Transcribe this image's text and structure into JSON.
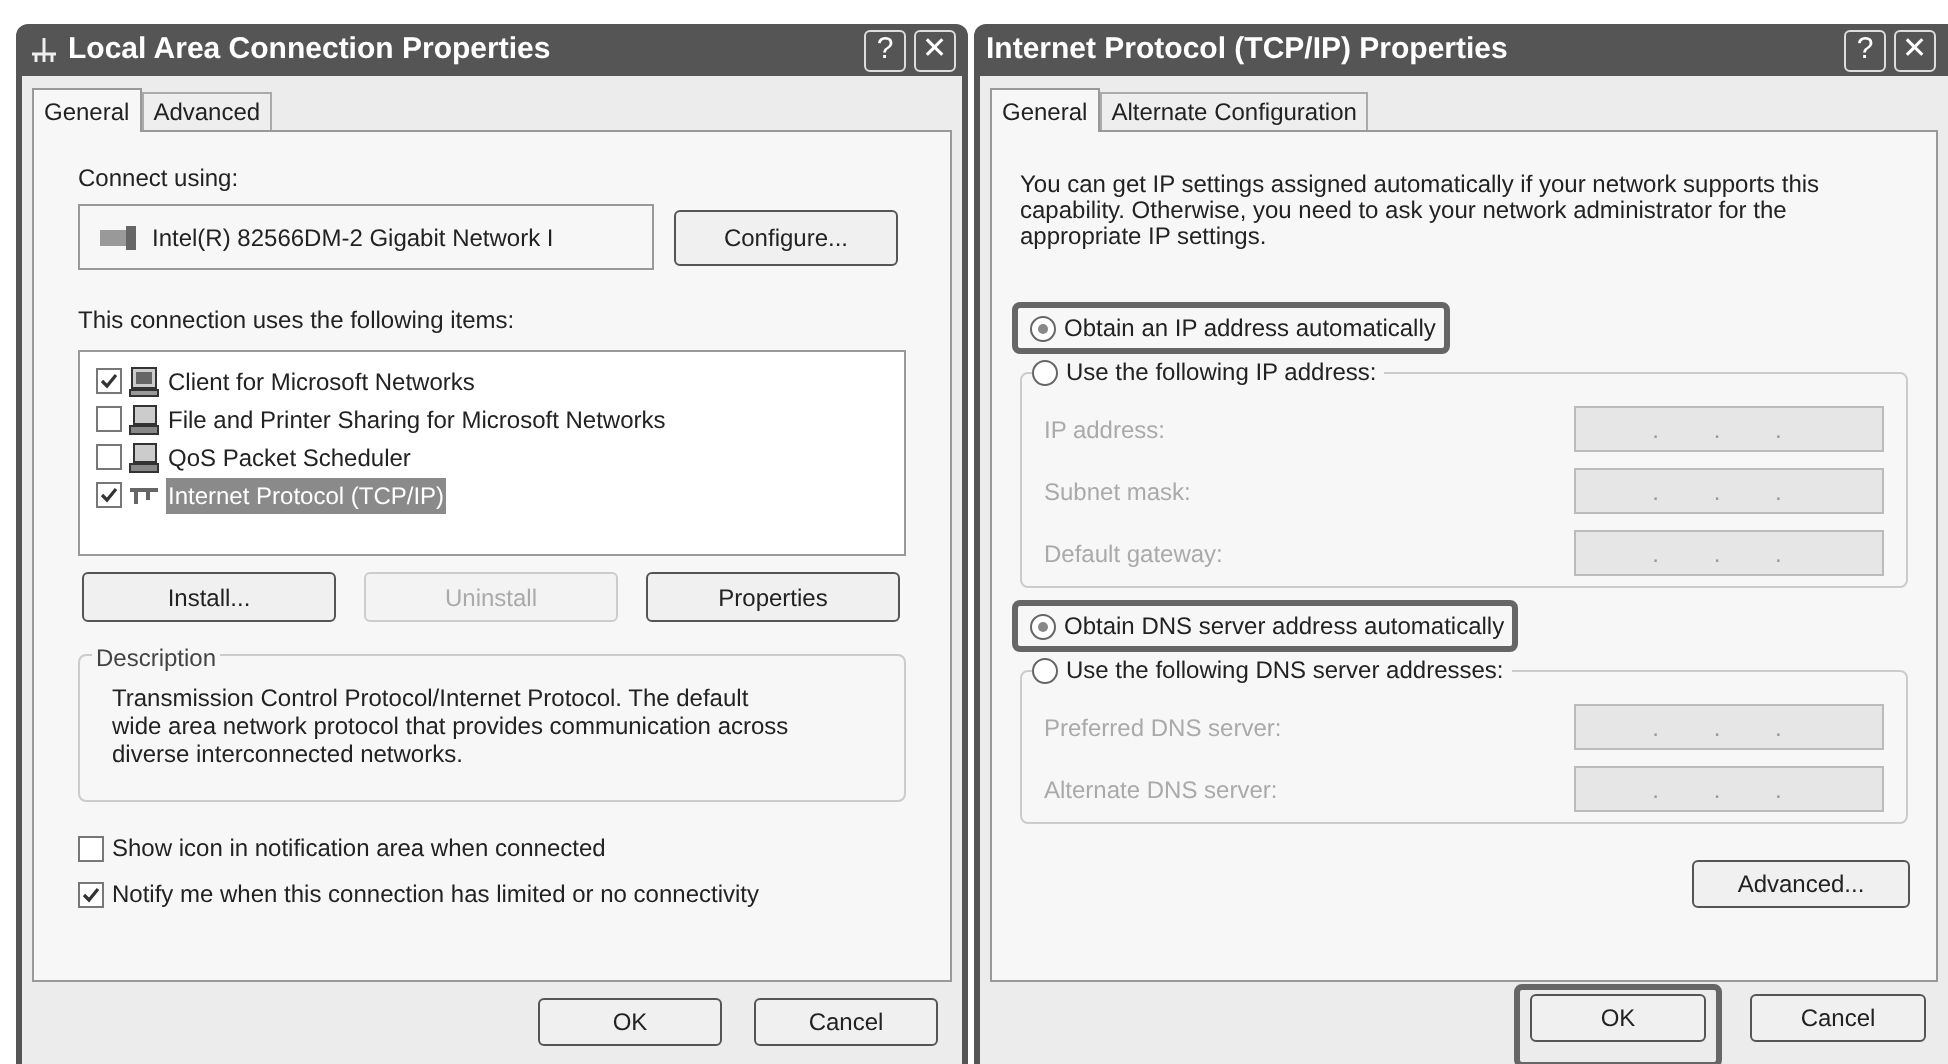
{
  "lan_dialog": {
    "title": "Local Area Connection Properties",
    "title_buttons": [
      "?",
      "✕"
    ],
    "tabs": [
      {
        "label": "General",
        "selected": true
      },
      {
        "label": "Advanced",
        "selected": false
      }
    ],
    "connect_using_label": "Connect using:",
    "adapter": "Intel(R) 82566DM-2 Gigabit Network I",
    "configure_button": "Configure...",
    "items_label": "This connection uses the following items:",
    "items": [
      {
        "label": "Client for Microsoft Networks",
        "checked": true,
        "selected": false,
        "kind": "client"
      },
      {
        "label": "File and Printer Sharing for Microsoft Networks",
        "checked": false,
        "selected": false,
        "kind": "service"
      },
      {
        "label": "QoS Packet Scheduler",
        "checked": false,
        "selected": false,
        "kind": "service"
      },
      {
        "label": "Internet Protocol (TCP/IP)",
        "checked": true,
        "selected": true,
        "kind": "protocol"
      }
    ],
    "item_buttons": [
      {
        "label": "Install...",
        "disabled": false
      },
      {
        "label": "Uninstall",
        "disabled": true
      },
      {
        "label": "Properties",
        "disabled": false
      }
    ],
    "description_title": "Description",
    "description": "Transmission Control Protocol/Internet Protocol. The default wide area network protocol that provides communication across diverse interconnected networks.",
    "options": [
      {
        "label": "Show icon in notification area when connected",
        "checked": false
      },
      {
        "label": "Notify me when this connection has limited or no connectivity",
        "checked": true
      }
    ],
    "buttons": [
      "OK",
      "Cancel"
    ]
  },
  "tcpip_dialog": {
    "title": "Internet Protocol (TCP/IP) Properties",
    "title_buttons": [
      "?",
      "✕"
    ],
    "tabs": [
      {
        "label": "General",
        "selected": true
      },
      {
        "label": "Alternate Configuration",
        "selected": false
      }
    ],
    "intro": "You can get IP settings assigned automatically if your network supports this capability. Otherwise, you need to ask your network administrator for the appropriate IP settings.",
    "sections": [
      {
        "auto": {
          "label": "Obtain an IP address automatically",
          "selected": true,
          "highlighted": true
        },
        "manual": {
          "label": "Use the following IP address:",
          "selected": false
        },
        "fields": [
          {
            "label": "IP address:",
            "value": ". . .",
            "disabled": true
          },
          {
            "label": "Subnet mask:",
            "value": ". . .",
            "disabled": true
          },
          {
            "label": "Default gateway:",
            "value": ". . .",
            "disabled": true
          }
        ]
      },
      {
        "auto": {
          "label": "Obtain DNS server address automatically",
          "selected": true,
          "highlighted": true
        },
        "manual": {
          "label": "Use the following DNS server addresses:",
          "selected": false
        },
        "fields": [
          {
            "label": "Preferred DNS server:",
            "value": ". . .",
            "disabled": true
          },
          {
            "label": "Alternate DNS server:",
            "value": ". . .",
            "disabled": true
          }
        ]
      }
    ],
    "advanced_button": "Advanced...",
    "buttons": [
      {
        "label": "OK",
        "highlighted": true
      },
      {
        "label": "Cancel",
        "highlighted": false
      }
    ]
  }
}
